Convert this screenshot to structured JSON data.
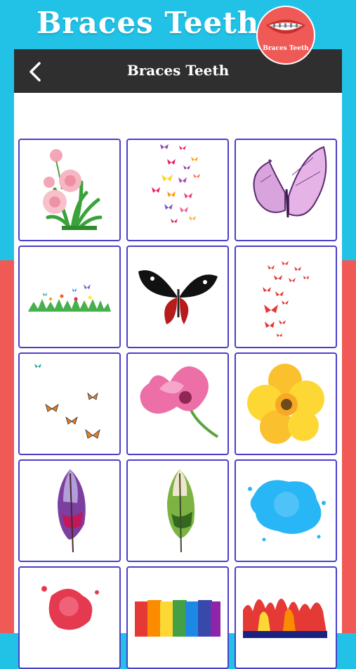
{
  "banner": {
    "title": "Braces Teeth"
  },
  "logo": {
    "text": "Braces Teeth"
  },
  "app_bar": {
    "title": "Braces Teeth",
    "back_icon": "chevron-left-icon"
  },
  "stickers": [
    "pink-flowers-grass",
    "colorful-butterfly-swarm",
    "purple-butterfly",
    "grass-with-butterflies",
    "black-red-butterfly",
    "red-butterfly-swarm",
    "orange-butterflies",
    "pink-flower",
    "yellow-flower",
    "purple-feather",
    "green-feather",
    "blue-paint-splash",
    "red-paint-splash",
    "rainbow-paint-strip",
    "fire-paint-strip"
  ],
  "colors": {
    "top_bg": "#22c2e6",
    "bottom_bg": "#ef5a56",
    "app_bar": "#2f2f2f",
    "tile_border": "#4a3fc9"
  }
}
